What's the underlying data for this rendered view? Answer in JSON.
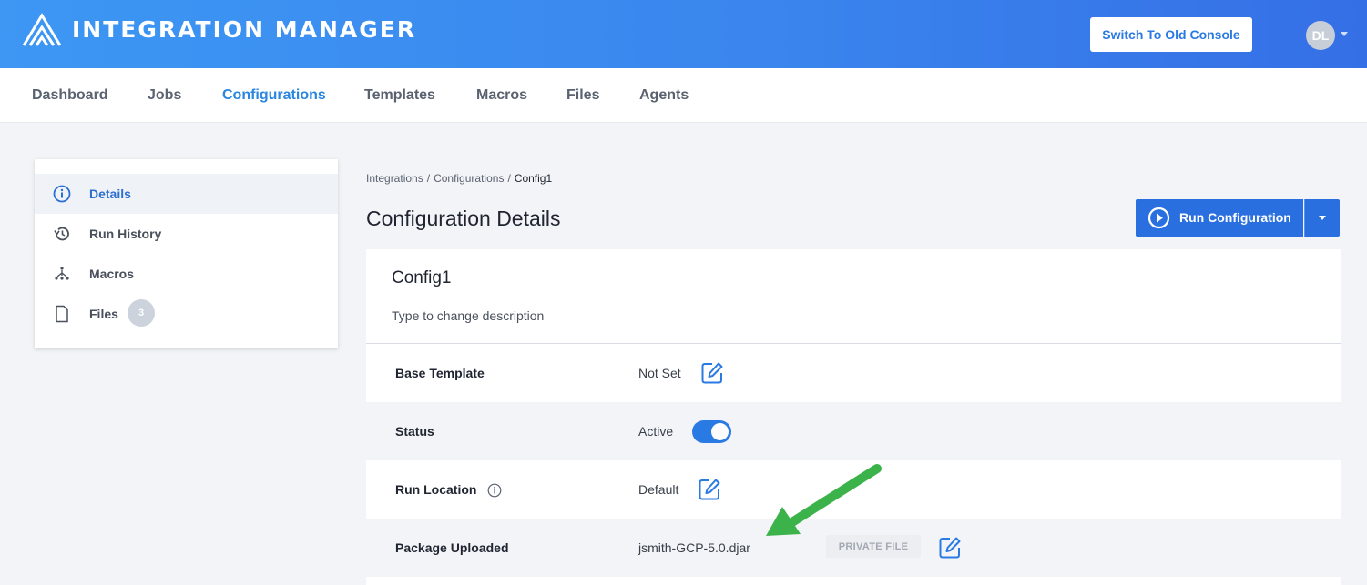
{
  "header": {
    "app_title": "INTEGRATION MANAGER",
    "switch_console_label": "Switch To Old Console",
    "avatar_initials": "DL",
    "brand_color": "#3a86ee"
  },
  "nav": {
    "items": [
      {
        "label": "Dashboard",
        "active": false
      },
      {
        "label": "Jobs",
        "active": false
      },
      {
        "label": "Configurations",
        "active": true
      },
      {
        "label": "Templates",
        "active": false
      },
      {
        "label": "Macros",
        "active": false
      },
      {
        "label": "Files",
        "active": false
      },
      {
        "label": "Agents",
        "active": false
      }
    ]
  },
  "sidebar": {
    "items": [
      {
        "label": "Details",
        "icon": "info-circle-icon",
        "active": true
      },
      {
        "label": "Run History",
        "icon": "history-icon",
        "active": false
      },
      {
        "label": "Macros",
        "icon": "macros-icon",
        "active": false
      },
      {
        "label": "Files",
        "icon": "file-icon",
        "active": false,
        "badge": "3"
      }
    ]
  },
  "breadcrumb": {
    "items": [
      "Integrations",
      "Configurations",
      "Config1"
    ]
  },
  "page": {
    "title": "Configuration Details",
    "run_button_label": "Run Configuration",
    "run_button_color": "#2a6fe0"
  },
  "config": {
    "name": "Config1",
    "description_placeholder": "Type to change description",
    "rows": {
      "base_template": {
        "label": "Base Template",
        "value": "Not Set"
      },
      "status": {
        "label": "Status",
        "value": "Active",
        "enabled": true
      },
      "run_location": {
        "label": "Run Location",
        "value": "Default"
      },
      "package": {
        "label": "Package Uploaded",
        "value": "jsmith-GCP-5.0.djar",
        "badge": "PRIVATE FILE"
      }
    }
  },
  "annotation": {
    "arrow_color": "#3bb34a"
  }
}
